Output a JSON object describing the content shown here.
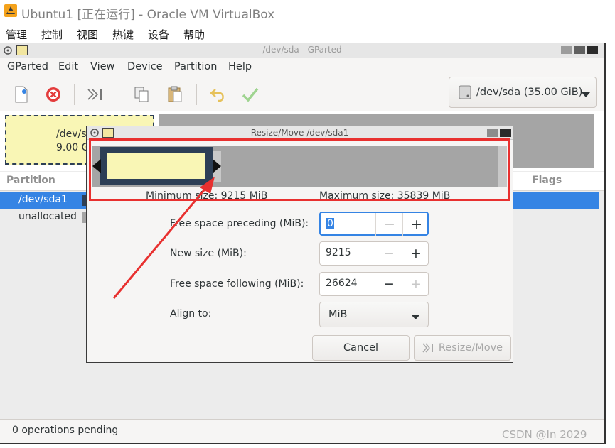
{
  "vbox": {
    "title": "Ubuntu1 [正在运行] - Oracle VM VirtualBox",
    "menu": [
      "管理",
      "控制",
      "视图",
      "热键",
      "设备",
      "帮助"
    ]
  },
  "gparted": {
    "window_title": "/dev/sda - GParted",
    "menu": [
      "GParted",
      "Edit",
      "View",
      "Device",
      "Partition",
      "Help"
    ],
    "device": "/dev/sda (35.00 GiB)",
    "graph_partition": {
      "name": "/dev/s",
      "size": "9.00 G"
    },
    "columns": {
      "partition": "Partition",
      "flags": "Flags"
    },
    "rows": [
      "/dev/sda1",
      "unallocated"
    ],
    "status": "0 operations pending"
  },
  "dialog": {
    "title": "Resize/Move /dev/sda1",
    "min_size": "Minimum size: 9215 MiB",
    "max_size": "Maximum size: 35839 MiB",
    "fields": {
      "preceding": {
        "label": "Free space preceding (MiB):",
        "value": "0"
      },
      "new_size": {
        "label": "New size (MiB):",
        "value": "9215"
      },
      "following": {
        "label": "Free space following (MiB):",
        "value": "26624"
      },
      "align": {
        "label": "Align to:",
        "value": "MiB"
      }
    },
    "cancel": "Cancel",
    "resize": "Resize/Move"
  },
  "watermark": "CSDN @In 2029",
  "colors": {
    "selection": "#3584e4",
    "partition_fill": "#f9f6b5",
    "partition_border": "#2d3f56",
    "unallocated": "#a5a5a5",
    "annotation": "#e8302f"
  }
}
